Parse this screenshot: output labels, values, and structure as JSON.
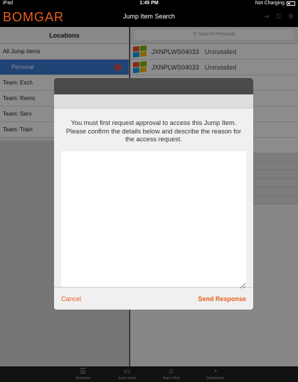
{
  "status_bar": {
    "carrier": "iPad",
    "time": "1:45 PM",
    "charging": "Not Charging"
  },
  "nav": {
    "brand": "BOMGAR",
    "title": "Jump Item Search"
  },
  "locations": {
    "header": "Locations",
    "items": [
      {
        "label": "All Jump Items"
      },
      {
        "label": "Personal"
      },
      {
        "label": "Team: Exch"
      },
      {
        "label": "Team: Remo"
      },
      {
        "label": "Team: Serv"
      },
      {
        "label": "Team: Train"
      }
    ]
  },
  "search": {
    "placeholder": "Search Personal"
  },
  "jump_items": [
    {
      "name": "JXNPLWS04033",
      "status": "Uninstalled"
    },
    {
      "name": "JXNPLWS04033",
      "status": "Uninstalled"
    }
  ],
  "tabs": [
    {
      "label": "Sessions"
    },
    {
      "label": "Jump Items"
    },
    {
      "label": "Team Chat"
    },
    {
      "label": "Dashboard"
    }
  ],
  "modal": {
    "message": "You must first request approval to access this Jump Item. Please confirm the details below and describe the reason for the access request.",
    "reason_value": "",
    "cancel_label": "Cancel",
    "send_label": "Send Response"
  },
  "colors": {
    "accent": "#e8601c",
    "selected": "#3b7dd8"
  }
}
